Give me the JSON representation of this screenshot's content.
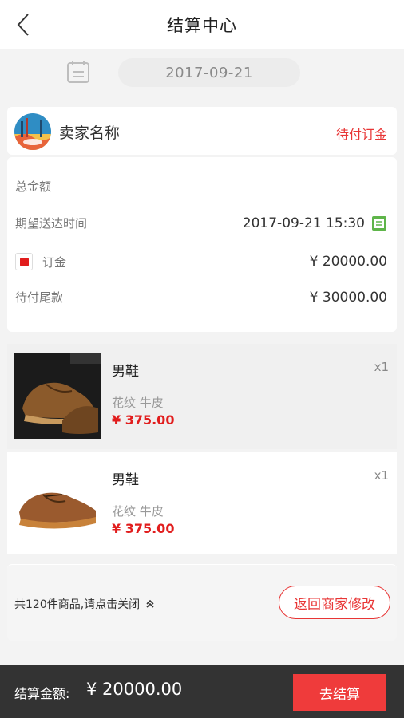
{
  "header": {
    "title": "结算中心",
    "back_icon": "back-icon"
  },
  "date_bar": {
    "date": "2017-09-21",
    "icon": "calendar-icon"
  },
  "seller": {
    "name": "卖家名称",
    "status": "待付订金",
    "status_color": "#e83535"
  },
  "summary": {
    "total_label": "总金额",
    "delivery_label": "期望送达时间",
    "delivery_value": "2017-09-21 15:30",
    "deposit_label": "订金",
    "deposit_value": "¥ 20000.00",
    "balance_label": "待付尾款",
    "balance_value": "¥ 30000.00"
  },
  "items": [
    {
      "name": "男鞋",
      "qty": "x1",
      "spec": "花纹 牛皮",
      "price": "¥ 375.00"
    },
    {
      "name": "男鞋",
      "qty": "x1",
      "spec": "花纹 牛皮",
      "price": "¥ 375.00"
    }
  ],
  "footer": {
    "total_items": "共120件商品,请点击关闭",
    "return_button": "返回商家修改"
  },
  "bottom_bar": {
    "pay_label": "结算金额:",
    "pay_amount": "¥ 20000.00",
    "checkout_button": "去结算"
  },
  "colors": {
    "accent": "#ef3b3b",
    "bottom_bar": "#333333"
  }
}
